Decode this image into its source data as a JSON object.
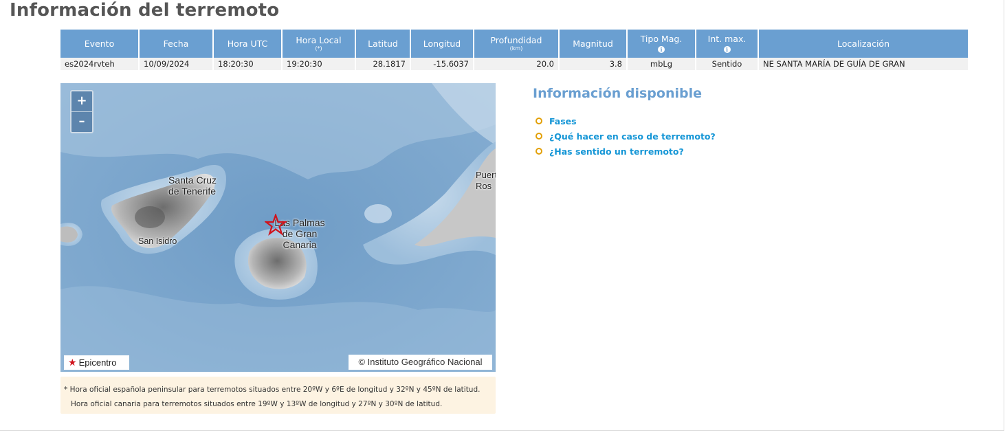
{
  "page": {
    "title": "Información del terremoto"
  },
  "table": {
    "headers": [
      {
        "label": "Evento"
      },
      {
        "label": "Fecha"
      },
      {
        "label": "Hora UTC"
      },
      {
        "label": "Hora Local",
        "sub": "(*)"
      },
      {
        "label": "Latitud"
      },
      {
        "label": "Longitud"
      },
      {
        "label": "Profundidad",
        "sub": "(km)"
      },
      {
        "label": "Magnitud"
      },
      {
        "label": "Tipo Mag.",
        "info": "i"
      },
      {
        "label": "Int. max.",
        "info": "i"
      },
      {
        "label": "Localización"
      }
    ],
    "row": {
      "evento": "es2024rvteh",
      "fecha": "10/09/2024",
      "hora_utc": "18:20:30",
      "hora_local": "19:20:30",
      "latitud": "28.1817",
      "longitud": "-15.6037",
      "profundidad": "20.0",
      "magnitud": "3.8",
      "tipo_mag": "mbLg",
      "int_max": "Sentido",
      "localizacion": "NE SANTA MARÍA DE GUÍA DE GRAN"
    }
  },
  "map": {
    "zoom_in": "+",
    "zoom_out": "–",
    "labels": {
      "santa_cruz_1": "Santa Cruz",
      "santa_cruz_2": "de Tenerife",
      "san_isidro": "San Isidro",
      "las_palmas_1": "Las Palmas",
      "las_palmas_2": "de Gran",
      "las_palmas_3": "Canaria",
      "puerto_1": "Puert",
      "puerto_2": "Ros"
    },
    "legend": "Epicentro",
    "attribution": "© Instituto Geográfico Nacional",
    "epicenter_color": "#d0121b"
  },
  "note": {
    "line1": "* Hora oficial española peninsular para terremotos situados entre 20ºW y 6ºE de longitud y 32ºN y 45ºN de latitud.",
    "line2": "Hora oficial canaria para terremotos situados entre 19ºW y 13ºW de longitud y 27ºN y 30ºN de latitud."
  },
  "available": {
    "title": "Información disponible",
    "links": [
      "Fases",
      "¿Qué hacer en caso de terremoto?",
      "¿Has sentido un terremoto?"
    ]
  },
  "colors": {
    "header_blue": "#6a9fd1",
    "link_blue": "#1596d6",
    "bullet_orange": "#e3a10a",
    "note_bg": "#fdf3e2"
  }
}
